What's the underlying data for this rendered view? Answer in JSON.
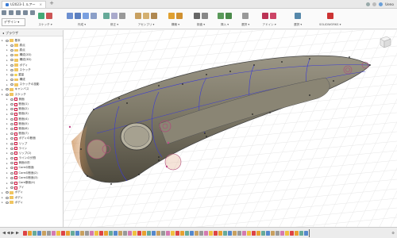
{
  "window": {
    "tab_title": "U2023-1 ルアー",
    "user_label": "Ueno"
  },
  "toolbar": {
    "workspace_label": "デザイン ▾",
    "groups": [
      {
        "label": "スケッチ ▾"
      },
      {
        "label": "作成 ▾"
      },
      {
        "label": "修正 ▾"
      },
      {
        "label": "アセンブリ ▾"
      },
      {
        "label": "構築 ▾"
      },
      {
        "label": "検査 ▾"
      },
      {
        "label": "挿入 ▾"
      },
      {
        "label": "選択 ▾"
      },
      {
        "label": "アドイン ▾"
      },
      {
        "label": "選択 ▾"
      },
      {
        "label": "SOLIDWORKS ▾"
      }
    ]
  },
  "browser": {
    "header": "ブラウザ",
    "items": [
      {
        "level": 0,
        "icon": "folder",
        "label": "基本"
      },
      {
        "level": 1,
        "icon": "folder",
        "label": "原点"
      },
      {
        "level": 1,
        "icon": "folder",
        "label": "原点"
      },
      {
        "level": 1,
        "icon": "folder",
        "label": "構成(2D)"
      },
      {
        "level": 1,
        "icon": "folder",
        "label": "構成(3D)"
      },
      {
        "level": 1,
        "icon": "folder",
        "label": "ボディ"
      },
      {
        "level": 1,
        "icon": "folder",
        "label": "スケッチ"
      },
      {
        "level": 1,
        "icon": "bulb",
        "label": "重量"
      },
      {
        "level": 1,
        "icon": "folder",
        "label": "構成"
      },
      {
        "level": 1,
        "icon": "folder",
        "label": "スケッチの投影"
      },
      {
        "level": 0,
        "icon": "folder",
        "label": "キャンバス"
      },
      {
        "level": 0,
        "icon": "folder",
        "label": "スケッチ"
      },
      {
        "level": 1,
        "icon": "sketch",
        "label": "側面"
      },
      {
        "level": 1,
        "icon": "sketch",
        "label": "断面(1)"
      },
      {
        "level": 1,
        "icon": "sketch",
        "label": "断面(2)"
      },
      {
        "level": 1,
        "icon": "sketch",
        "label": "断面(3)"
      },
      {
        "level": 1,
        "icon": "sketch",
        "label": "断面(4)"
      },
      {
        "level": 1,
        "icon": "sketch",
        "label": "断面(5)"
      },
      {
        "level": 1,
        "icon": "sketch",
        "label": "断面(6)"
      },
      {
        "level": 1,
        "icon": "sketch",
        "label": "断面(7)"
      },
      {
        "level": 1,
        "icon": "sketch",
        "label": "ボディの断面"
      },
      {
        "level": 1,
        "icon": "sketch",
        "label": "リップ"
      },
      {
        "level": 1,
        "icon": "sketch",
        "label": "ライン"
      },
      {
        "level": 1,
        "icon": "sketch",
        "label": "リップ(2)"
      },
      {
        "level": 1,
        "icon": "sketch",
        "label": "ラインの分割"
      },
      {
        "level": 1,
        "icon": "sketch",
        "label": "側面の形"
      },
      {
        "level": 1,
        "icon": "sketch",
        "label": "Coreの断面"
      },
      {
        "level": 1,
        "icon": "sketch",
        "label": "Coreの断面(2)"
      },
      {
        "level": 1,
        "icon": "sketch",
        "label": "Coreの断面(3)"
      },
      {
        "level": 1,
        "icon": "sketch",
        "label": "Core断面(4)"
      },
      {
        "level": 1,
        "icon": "sketch",
        "label": "アイ"
      },
      {
        "level": 0,
        "icon": "folder",
        "label": "ボディ"
      },
      {
        "level": 0,
        "icon": "folder",
        "label": "ボディ"
      },
      {
        "level": 0,
        "icon": "folder",
        "label": "ボディ"
      }
    ]
  },
  "timeline": {
    "feature_count": 60
  }
}
